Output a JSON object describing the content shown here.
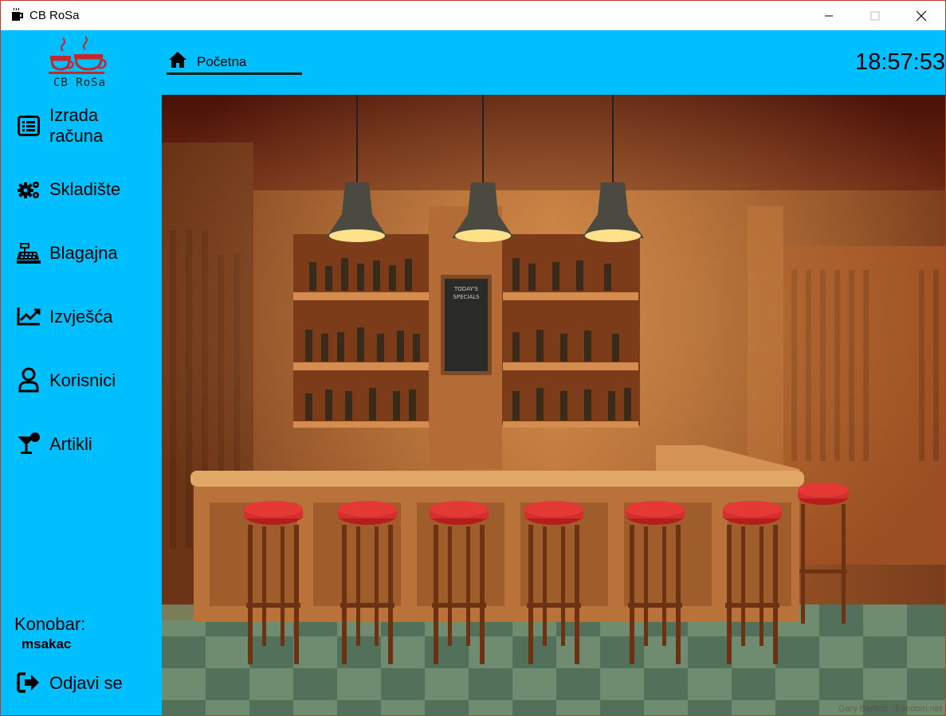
{
  "window": {
    "title": "CB RoSa",
    "controls": [
      "minimize",
      "maximize",
      "close"
    ]
  },
  "logo": {
    "text": "CB RoSa"
  },
  "sidebar": {
    "items": [
      {
        "label": "Izrada računa",
        "icon": "receipt-list-icon"
      },
      {
        "label": "Skladište",
        "icon": "gears-icon"
      },
      {
        "label": "Blagajna",
        "icon": "cash-register-icon"
      },
      {
        "label": "Izvješća",
        "icon": "line-chart-icon"
      },
      {
        "label": "Korisnici",
        "icon": "user-icon"
      },
      {
        "label": "Artikli",
        "icon": "cocktail-icon"
      }
    ],
    "user_caption": "Konobar:",
    "user_name": "msakac",
    "logout_label": "Odjavi se"
  },
  "header": {
    "tab_label": "Početna",
    "clock": "18:57:53"
  },
  "scene": {
    "chalkboard_text": "TODAY'S SPECIALS",
    "watermark": "Gary Bartlett - freedom.net"
  },
  "colors": {
    "sidebar_bg": "#00bfff",
    "logo_red": "#c62828",
    "stool_red": "#b71c1c"
  }
}
